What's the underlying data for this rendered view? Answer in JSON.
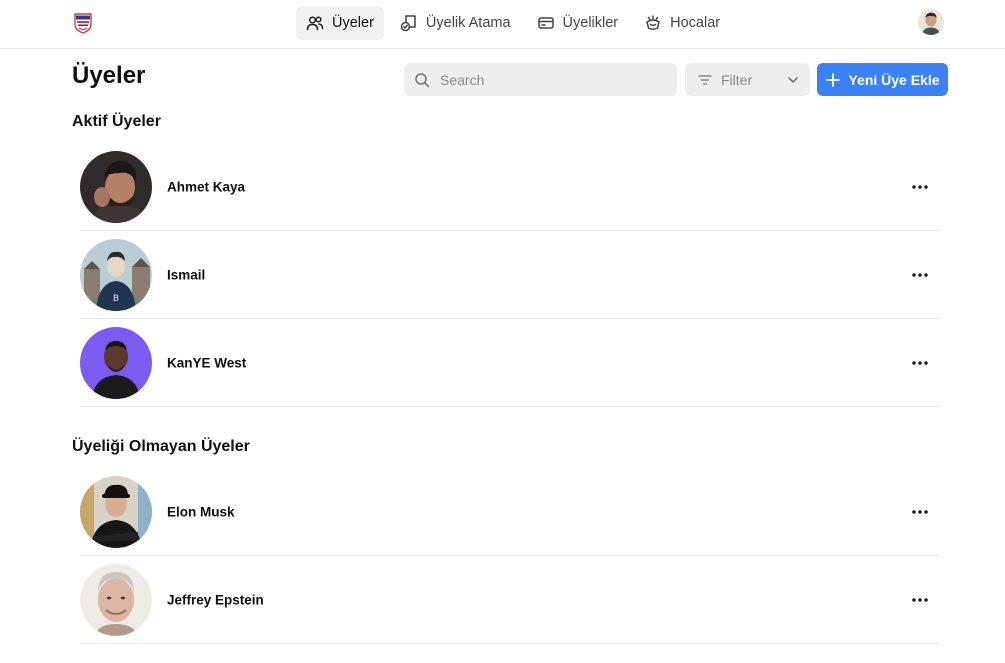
{
  "nav": {
    "items": [
      {
        "label": "Üyeler",
        "icon": "users-icon",
        "active": true
      },
      {
        "label": "Üyelik Atama",
        "icon": "assign-membership-icon",
        "active": false
      },
      {
        "label": "Üyelikler",
        "icon": "card-icon",
        "active": false
      },
      {
        "label": "Hocalar",
        "icon": "trainer-icon",
        "active": false
      }
    ]
  },
  "page": {
    "title": "Üyeler"
  },
  "search": {
    "placeholder": "Search",
    "value": ""
  },
  "filter": {
    "label": "Filter"
  },
  "actions": {
    "add_member": "Yeni Üye Ekle"
  },
  "sections": {
    "active": {
      "title": "Aktif Üyeler",
      "members": [
        {
          "name": "Ahmet Kaya"
        },
        {
          "name": "Ismail"
        },
        {
          "name": "KanYE West"
        }
      ]
    },
    "inactive": {
      "title": "Üyeliği Olmayan Üyeler",
      "members": [
        {
          "name": "Elon Musk"
        },
        {
          "name": "Jeffrey Epstein"
        }
      ]
    }
  },
  "colors": {
    "accent": "#3b82f6",
    "input_bg": "#eeeeee",
    "nav_active_bg": "#f1f1f1",
    "divider": "#e8e8e8"
  }
}
